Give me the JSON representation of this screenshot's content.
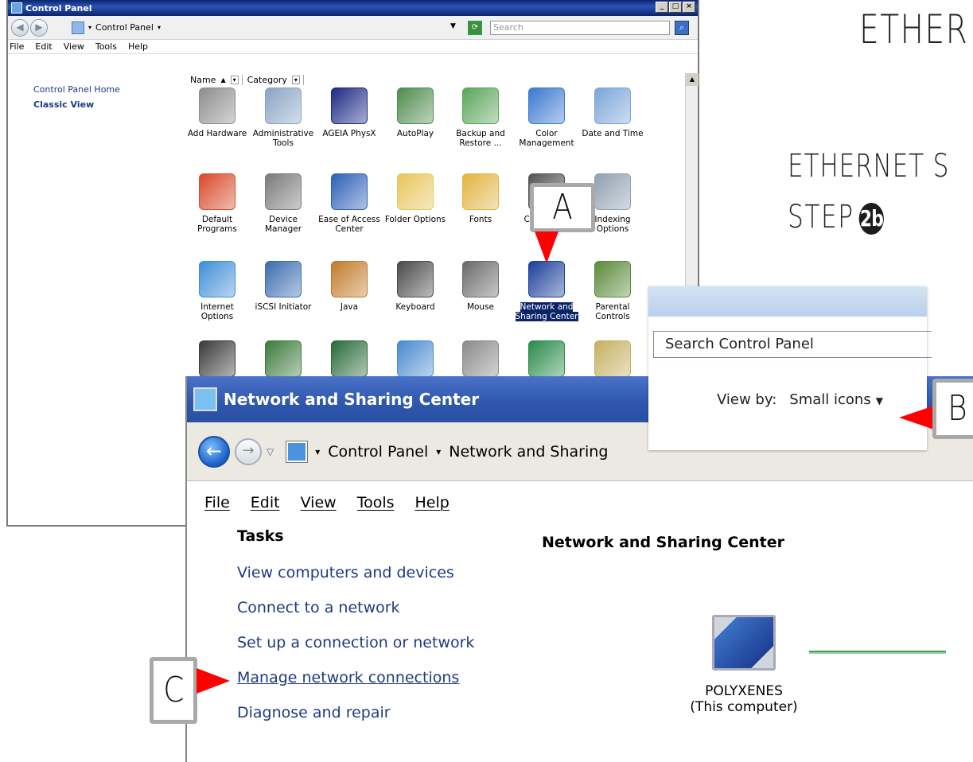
{
  "headings": {
    "top": "ETHER",
    "sub": "ETHERNET S",
    "step_word": "STEP",
    "step_badge": "2b"
  },
  "control_panel": {
    "title": "Control Panel",
    "address_label": "Control Panel",
    "search_placeholder": "Search",
    "menu": [
      "File",
      "Edit",
      "View",
      "Tools",
      "Help"
    ],
    "sidebar": [
      "Control Panel Home",
      "Classic View"
    ],
    "columns": [
      "Name",
      "Category"
    ],
    "items": [
      {
        "label": "Add Hardware",
        "color": "#8d8d8d"
      },
      {
        "label": "Administrative Tools",
        "color": "#8aa4c4"
      },
      {
        "label": "AGEIA PhysX",
        "color": "#1c2a86"
      },
      {
        "label": "AutoPlay",
        "color": "#4e8c4e"
      },
      {
        "label": "Backup and Restore ...",
        "color": "#5aa55a"
      },
      {
        "label": "Color Management",
        "color": "#3a78d0"
      },
      {
        "label": "Date and Time",
        "color": "#7aa5d8"
      },
      {
        "label": "Default Programs",
        "color": "#d84a2a"
      },
      {
        "label": "Device Manager",
        "color": "#7a7a7a"
      },
      {
        "label": "Ease of Access Center",
        "color": "#2d5fb8"
      },
      {
        "label": "Folder Options",
        "color": "#e8c55a"
      },
      {
        "label": "Fonts",
        "color": "#e2b440"
      },
      {
        "label": "Controllers",
        "color": "#555555"
      },
      {
        "label": "Indexing Options",
        "color": "#8fa0b0"
      },
      {
        "label": "Internet Options",
        "color": "#3f8ed8"
      },
      {
        "label": "iSCSI Initiator",
        "color": "#3a6cb0"
      },
      {
        "label": "Java",
        "color": "#c27a2a"
      },
      {
        "label": "Keyboard",
        "color": "#4a4a4a"
      },
      {
        "label": "Mouse",
        "color": "#6a6a6a"
      },
      {
        "label": "Network and Sharing Center",
        "color": "#1b3f9a"
      },
      {
        "label": "Parental Controls",
        "color": "#5a8a3a"
      },
      {
        "label": "",
        "color": "#3a3a3a"
      },
      {
        "label": "",
        "color": "#3c7a3c"
      },
      {
        "label": "",
        "color": "#2a6a3a"
      },
      {
        "label": "",
        "color": "#4a8ad0"
      },
      {
        "label": "",
        "color": "#8a8a8a"
      },
      {
        "label": "",
        "color": "#2a8a4a"
      },
      {
        "label": "",
        "color": "#c4b060"
      }
    ]
  },
  "nsc": {
    "title": "Network and Sharing Center",
    "breadcrumb": [
      "Control Panel",
      "Network and Sharing"
    ],
    "menu": [
      "File",
      "Edit",
      "View",
      "Tools",
      "Help"
    ],
    "tasks_title": "Tasks",
    "tasks": [
      "View computers and devices",
      "Connect to a network",
      "Set up a connection or network",
      "Manage network connections",
      "Diagnose and repair"
    ],
    "main_title": "Network and Sharing Center",
    "computer_name": "POLYXENES",
    "computer_sub": "(This computer)"
  },
  "inset": {
    "search_placeholder": "Search Control Panel",
    "view_by_label": "View by:",
    "view_by_value": "Small icons"
  },
  "callouts": {
    "a": "A",
    "b": "B",
    "c": "C"
  },
  "colors": {
    "callout_arrow": "#ff0000",
    "callout_border": "#a9a9a9"
  }
}
